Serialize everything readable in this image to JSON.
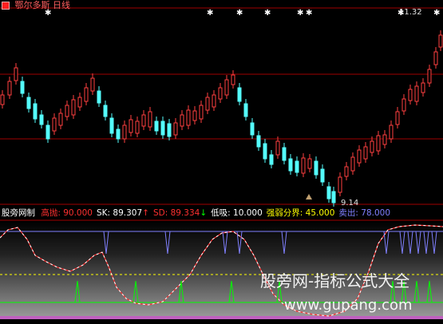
{
  "header": {
    "stock_name": "鄂尔多斯",
    "period": "日线",
    "menu_icon": "menu-icon"
  },
  "main_chart": {
    "high_label": "11.32",
    "low_label": "9.14",
    "signal_icon": "star-marker-icon"
  },
  "indicator": {
    "name": "股旁网制",
    "items": [
      {
        "label": "高抛:",
        "value": "90.000",
        "color": "#ff3030"
      },
      {
        "label": "SK:",
        "value": "89.307",
        "color": "#ffffff",
        "arrow": "↑",
        "arrow_color": "#ff3030"
      },
      {
        "label": "SD:",
        "value": "89.334",
        "color": "#ff3030",
        "arrow": "↓",
        "arrow_color": "#00ff00"
      },
      {
        "label": "低吸:",
        "value": "10.000",
        "color": "#ffffff"
      },
      {
        "label": "强弱分界:",
        "value": "45.000",
        "color": "#ffff00"
      },
      {
        "label": "卖出:",
        "value": "78.000",
        "color": "#8080ff"
      }
    ]
  },
  "watermark": {
    "title": "股旁网-指标公式大全",
    "url": "www.gupang.com"
  },
  "colors": {
    "up": "#ff4040",
    "down": "#54fcfc",
    "grid": "#a00000",
    "sk_line": "#ffffff",
    "sd_line": "#ff3030",
    "sell": "#8080ff",
    "buy": "#00ff00",
    "divider": "#ffff00"
  }
}
